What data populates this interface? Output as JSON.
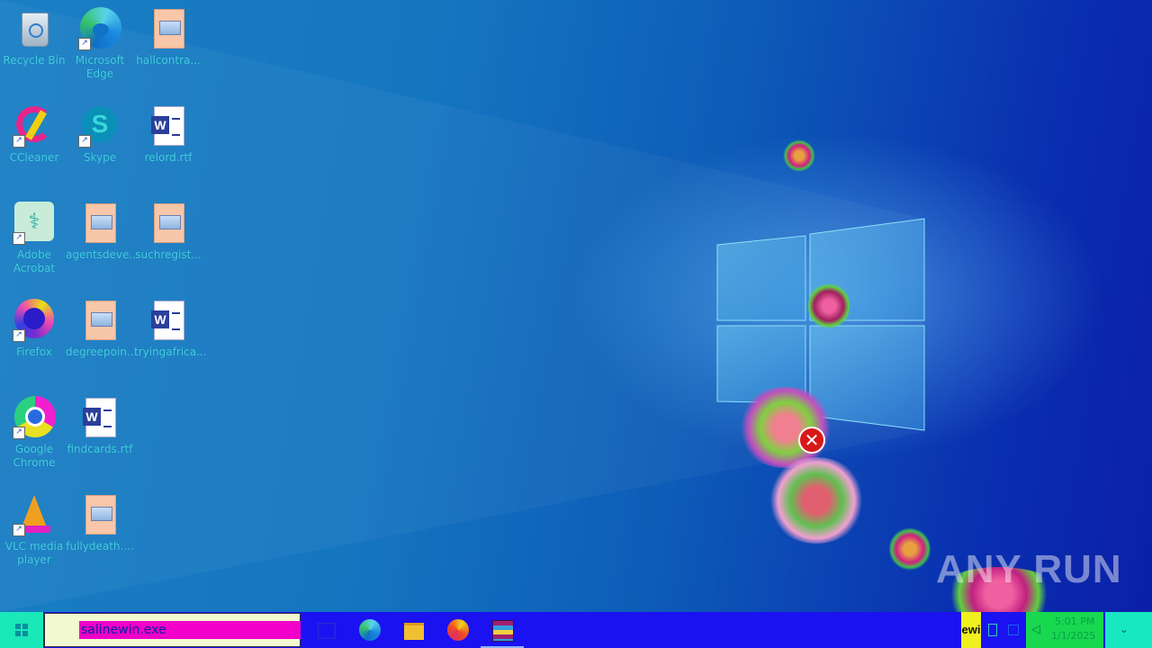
{
  "desktop": {
    "icons": [
      {
        "label": "Recycle Bin"
      },
      {
        "label": "Microsoft\nEdge"
      },
      {
        "label": "hallcontra..."
      },
      {
        "label": "CCleaner"
      },
      {
        "label": "Skype"
      },
      {
        "label": "relord.rtf"
      },
      {
        "label": "Adobe\nAcrobat"
      },
      {
        "label": "agentsdeve..."
      },
      {
        "label": "suchregist..."
      },
      {
        "label": "Firefox"
      },
      {
        "label": "degreepoin..."
      },
      {
        "label": "tryingafrica..."
      },
      {
        "label": "Google\nChrome"
      },
      {
        "label": "findcards.rtf"
      },
      {
        "label": "VLC media\nplayer"
      },
      {
        "label": "fullydeath...."
      }
    ]
  },
  "taskbar": {
    "search_text": "salinewin.exe",
    "start_icon": "windows-icon",
    "apps": [
      {
        "name": "task-view-icon"
      },
      {
        "name": "edge-icon"
      },
      {
        "name": "file-explorer-icon"
      },
      {
        "name": "firefox-icon"
      },
      {
        "name": "winrar-icon"
      }
    ],
    "tray_text": "ewi",
    "clock_time": "5:01 PM",
    "clock_date": "1/1/2025"
  },
  "watermark": "ANY RUN",
  "colors": {
    "taskbar": "#1a12f0",
    "search_highlight": "#f000c8",
    "icon_label": "#3fd0e0"
  }
}
